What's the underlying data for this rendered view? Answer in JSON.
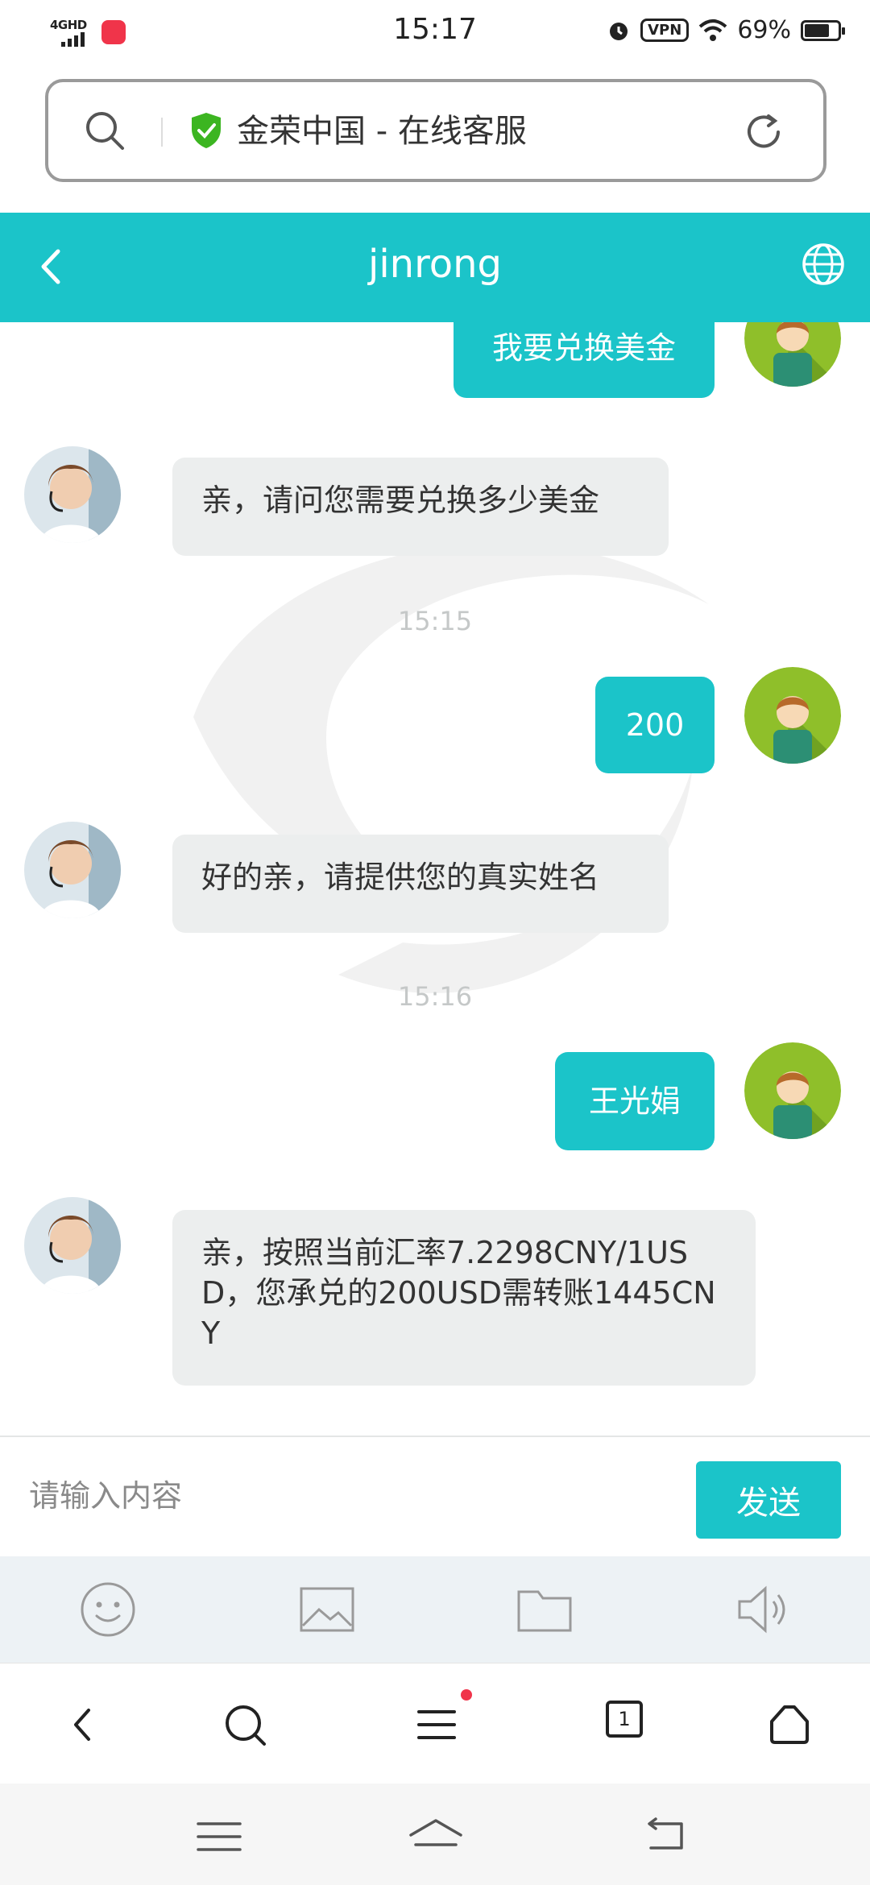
{
  "status_bar": {
    "network": "4GHD",
    "time": "15:17",
    "vpn": "VPN",
    "battery_percent_text": "69%",
    "battery_level": 0.69
  },
  "browser": {
    "url_title": "金荣中国 - 在线客服"
  },
  "chat": {
    "header_title": "jinrong",
    "messages": [
      {
        "side": "out",
        "text": "我要兑换美金"
      },
      {
        "side": "in",
        "text": "亲，请问您需要兑换多少美金"
      },
      {
        "side": "out",
        "text": "200"
      },
      {
        "side": "in",
        "text": "好的亲，请提供您的真实姓名"
      },
      {
        "side": "out",
        "text": "王光娟"
      },
      {
        "side": "in",
        "text": "亲，按照当前汇率7.2298CNY/1USD，您承兑的200USD需转账1445CNY"
      }
    ],
    "timestamps": [
      "15:15",
      "15:16"
    ]
  },
  "input": {
    "placeholder": "请输入内容",
    "send_label": "发送"
  },
  "tools": [
    "smiley-icon",
    "image-icon",
    "folder-icon",
    "speaker-icon"
  ],
  "browser_nav": {
    "tab_count": "1"
  },
  "colors": {
    "accent": "#1bc4c9",
    "incoming_bubble": "#eceeee",
    "tools_bg": "#edf2f5",
    "notification_dot": "#f0344a"
  }
}
